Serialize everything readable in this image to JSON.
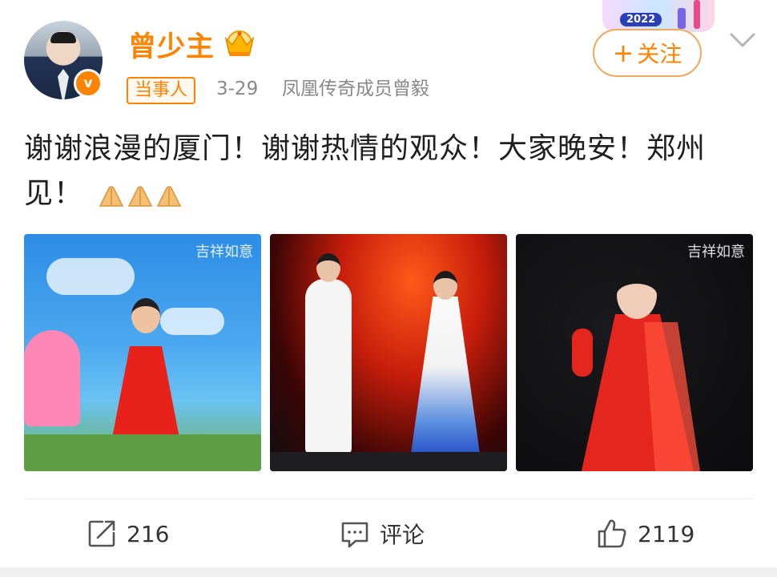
{
  "post": {
    "author": "曾少主",
    "tag": "当事人",
    "date": "3-29",
    "source": "凤凰传奇成员曾毅",
    "follow_label": "关注",
    "follow_plus": "+",
    "text": "谢谢浪漫的厦门！谢谢热情的观众！大家晚安！郑州见！",
    "emoji": [
      "folded-hands",
      "folded-hands",
      "folded-hands"
    ],
    "event_banner_year": "2022",
    "verified_mark": "v"
  },
  "photos": [
    {
      "watermark": "吉祥如意"
    },
    {
      "watermark": ""
    },
    {
      "watermark": "吉祥如意"
    }
  ],
  "actions": {
    "repost_count": "216",
    "comment_label": "评论",
    "like_count": "2119"
  },
  "colors": {
    "accent": "#ff8200",
    "text": "#1f1f1f",
    "meta": "#888888"
  }
}
